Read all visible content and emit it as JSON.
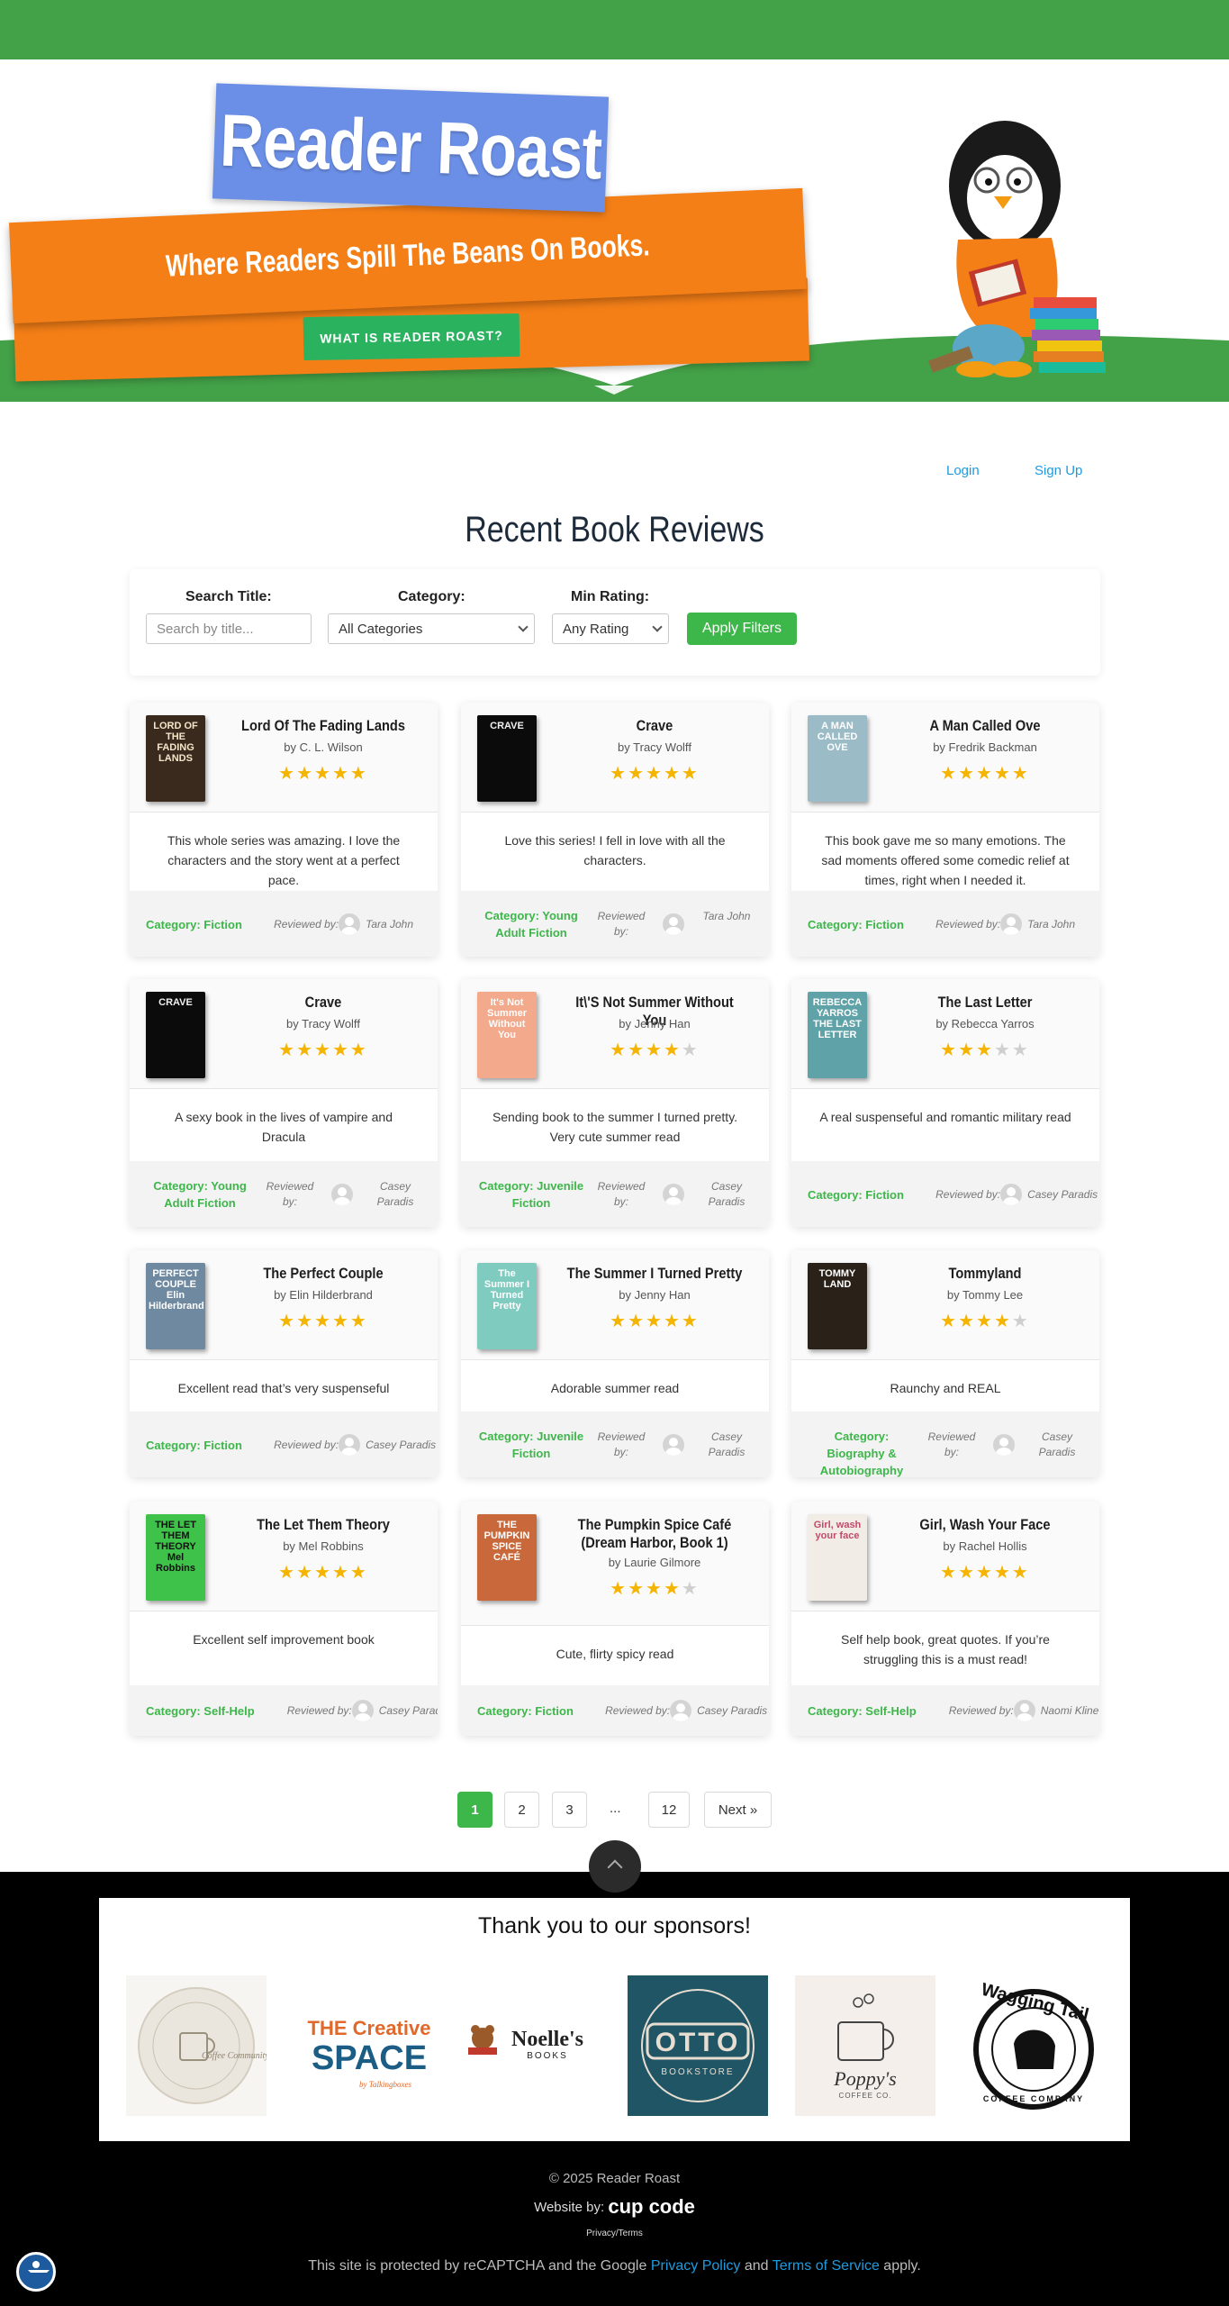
{
  "hero": {
    "title": "Reader Roast",
    "tagline": "Where Readers Spill The Beans On Books.",
    "cta_label": "WHAT IS READER ROAST?"
  },
  "auth": {
    "login": "Login",
    "signup": "Sign Up"
  },
  "page_title": "Recent Book Reviews",
  "filters": {
    "search_label": "Search Title:",
    "search_placeholder": "Search by title...",
    "category_label": "Category:",
    "category_value": "All Categories",
    "rating_label": "Min Rating:",
    "rating_value": "Any Rating",
    "apply_label": "Apply Filters"
  },
  "reviews": [
    {
      "title": "Lord Of The Fading Lands",
      "author": "by C. L. Wilson",
      "rating": 5,
      "review": "This whole series was amazing. I love the characters and the story went at a perfect pace.",
      "category": "Category: Fiction",
      "reviewed_by": "Reviewed by:",
      "reviewer": "Tara John",
      "cover_text": "LORD OF THE FADING LANDS",
      "cover_bg": "#3a2a1e",
      "cover_fg": "#f2e6c9"
    },
    {
      "title": "Crave",
      "author": "by Tracy Wolff",
      "rating": 5,
      "review": "Love this series! I fell in love with all the characters.",
      "category": "Category: Young Adult Fiction",
      "reviewed_by": "Reviewed by:",
      "reviewer": "Tara John",
      "cover_text": "CRAVE",
      "cover_bg": "#0b0b0b",
      "cover_fg": "#f0f0f0"
    },
    {
      "title": "A Man Called Ove",
      "author": "by Fredrik Backman",
      "rating": 5,
      "review": "This book gave me so many emotions. The sad moments offered some comedic relief at times, right when I needed it.",
      "category": "Category: Fiction",
      "reviewed_by": "Reviewed by:",
      "reviewer": "Tara John",
      "cover_text": "A MAN CALLED OVE",
      "cover_bg": "#9bbcc7",
      "cover_fg": "#ffffff"
    },
    {
      "title": "Crave",
      "author": "by Tracy Wolff",
      "rating": 5,
      "review": "A sexy book in the lives of vampire and Dracula",
      "category": "Category: Young Adult Fiction",
      "reviewed_by": "Reviewed by:",
      "reviewer": "Casey Paradis",
      "cover_text": "CRAVE",
      "cover_bg": "#0b0b0b",
      "cover_fg": "#f0f0f0"
    },
    {
      "title": "It\\'S Not Summer Without You",
      "author": "by Jenny Han",
      "rating": 4,
      "review": "Sending book to the summer I turned pretty. Very cute summer read",
      "category": "Category: Juvenile Fiction",
      "reviewed_by": "Reviewed by:",
      "reviewer": "Casey Paradis",
      "cover_text": "It's Not Summer Without You",
      "cover_bg": "#f2a98c",
      "cover_fg": "#ffffff"
    },
    {
      "title": "The Last Letter",
      "author": "by Rebecca Yarros",
      "rating": 3,
      "review": "A real suspenseful and romantic military read",
      "category": "Category: Fiction",
      "reviewed_by": "Reviewed by:",
      "reviewer": "Casey Paradis",
      "cover_text": "REBECCA YARROS THE LAST LETTER",
      "cover_bg": "#5fa3a8",
      "cover_fg": "#ffffff"
    },
    {
      "title": "The Perfect Couple",
      "author": "by Elin Hilderbrand",
      "rating": 5,
      "review": "Excellent read that’s very suspenseful",
      "category": "Category: Fiction",
      "reviewed_by": "Reviewed by:",
      "reviewer": "Casey Paradis",
      "cover_text": "PERFECT COUPLE Elin Hilderbrand",
      "cover_bg": "#6f8aa0",
      "cover_fg": "#ffffff"
    },
    {
      "title": "The Summer I Turned Pretty",
      "author": "by Jenny Han",
      "rating": 5,
      "review": "Adorable summer read",
      "category": "Category: Juvenile Fiction",
      "reviewed_by": "Reviewed by:",
      "reviewer": "Casey Paradis",
      "cover_text": "The Summer I Turned Pretty",
      "cover_bg": "#7fcbbf",
      "cover_fg": "#ffffff"
    },
    {
      "title": "Tommyland",
      "author": "by Tommy Lee",
      "rating": 4,
      "review": "Raunchy and REAL",
      "category": "Category: Biography & Autobiography",
      "reviewed_by": "Reviewed by:",
      "reviewer": "Casey Paradis",
      "cover_text": "TOMMY LAND",
      "cover_bg": "#2a2218",
      "cover_fg": "#ffffff"
    },
    {
      "title": "The Let Them Theory",
      "author": "by Mel Robbins",
      "rating": 5,
      "review": "Excellent self improvement book",
      "category": "Category: Self-Help",
      "reviewed_by": "Reviewed by:",
      "reviewer": "Casey Paradis",
      "cover_text": "THE LET THEM THEORY Mel Robbins",
      "cover_bg": "#3fc24a",
      "cover_fg": "#111111"
    },
    {
      "title": "The Pumpkin Spice Café (Dream Harbor, Book 1)",
      "author": "by Laurie Gilmore",
      "rating": 4,
      "review": "Cute, flirty spicy read",
      "category": "Category: Fiction",
      "reviewed_by": "Reviewed by:",
      "reviewer": "Casey Paradis",
      "cover_text": "THE PUMPKIN SPICE CAFÉ",
      "cover_bg": "#c9683a",
      "cover_fg": "#ffffff"
    },
    {
      "title": "Girl, Wash Your Face",
      "author": "by Rachel Hollis",
      "rating": 5,
      "review": "Self help book, great quotes. If you’re struggling this is a must read!",
      "category": "Category: Self-Help",
      "reviewed_by": "Reviewed by:",
      "reviewer": "Naomi Kline",
      "cover_text": "Girl, wash your face",
      "cover_bg": "#f1ece6",
      "cover_fg": "#c24a6a"
    }
  ],
  "pagination": {
    "pages": [
      "1",
      "2",
      "3"
    ],
    "dots": "...",
    "last": "12",
    "next": "Next »",
    "active": "1"
  },
  "footer": {
    "sponsors_title": "Thank you to our sponsors!",
    "sponsors": [
      {
        "name": "Coffee Community Connection",
        "icon": "coffee-cup-logo"
      },
      {
        "name": "THE Creative SPACE",
        "sub": "by Talkingboxes"
      },
      {
        "name": "Noelle's",
        "sub": "BOOKS"
      },
      {
        "name": "OTTO",
        "sub": "BOOKSTORE"
      },
      {
        "name": "Poppy's",
        "sub": "COFFEE CO."
      },
      {
        "name": "Wagging Tail",
        "sub": "COFFEE COMPANY"
      }
    ],
    "copyright": "© 2025 Reader Roast",
    "website_by": "Website by:",
    "brand": "cup code",
    "privacy": "Privacy/Terms",
    "recaptcha_pre": "This site is protected by reCAPTCHA and the Google ",
    "privacy_policy": "Privacy Policy",
    "and": " and ",
    "terms": "Terms of Service",
    "apply": " apply."
  },
  "colors": {
    "green": "#43a147",
    "orange": "#f57f17",
    "blue": "#6b8fe6",
    "link": "#1e9be0",
    "star": "#f5b400"
  }
}
